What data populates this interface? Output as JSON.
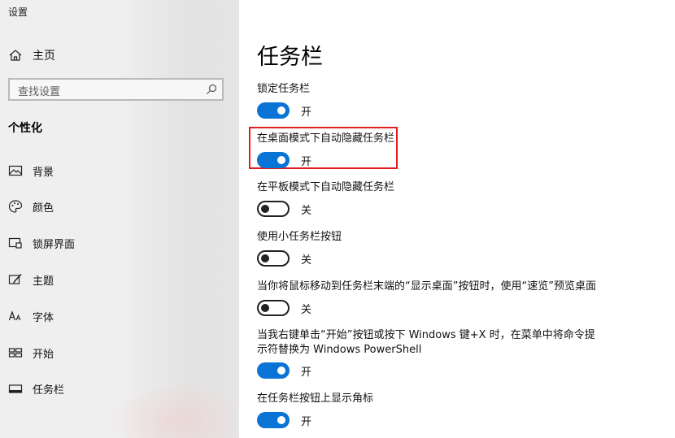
{
  "window": {
    "title": "设置"
  },
  "sidebar": {
    "home_label": "主页",
    "search_placeholder": "查找设置",
    "section_title": "个性化",
    "items": [
      {
        "label": "背景",
        "icon": "picture-icon"
      },
      {
        "label": "颜色",
        "icon": "palette-icon"
      },
      {
        "label": "锁屏界面",
        "icon": "lock-screen-icon"
      },
      {
        "label": "主题",
        "icon": "theme-icon"
      },
      {
        "label": "字体",
        "icon": "font-icon"
      },
      {
        "label": "开始",
        "icon": "start-icon"
      },
      {
        "label": "任务栏",
        "icon": "taskbar-icon"
      }
    ]
  },
  "main": {
    "title": "任务栏",
    "settings": [
      {
        "label": "锁定任务栏",
        "state": "开",
        "on": true
      },
      {
        "label": "在桌面模式下自动隐藏任务栏",
        "state": "开",
        "on": true,
        "highlighted": true
      },
      {
        "label": "在平板模式下自动隐藏任务栏",
        "state": "关",
        "on": false
      },
      {
        "label": "使用小任务栏按钮",
        "state": "关",
        "on": false
      },
      {
        "label": "当你将鼠标移动到任务栏末端的“显示桌面”按钮时，使用“速览”预览桌面",
        "state": "关",
        "on": false
      },
      {
        "label_line1": "当我右键单击“开始”按钮或按下 Windows 键+X 时，在菜单中将命令提",
        "label_line2": "示符替换为 Windows PowerShell",
        "state": "开",
        "on": true
      },
      {
        "label": "在任务栏按钮上显示角标",
        "state": "开",
        "on": true
      }
    ]
  },
  "colors": {
    "accent": "#0a74d6",
    "highlight_border": "#e21f1f",
    "sidebar_bg": "#efefef"
  }
}
